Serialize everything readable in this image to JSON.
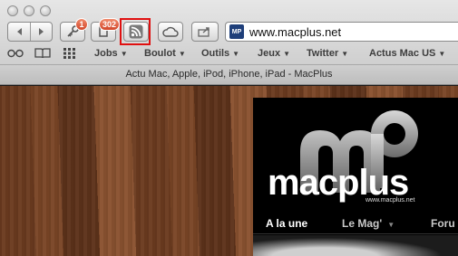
{
  "toolbar": {
    "reading_list_badge": "1",
    "bookmarks_badge": "302"
  },
  "address": {
    "favicon_text": "MP",
    "url": "www.macplus.net"
  },
  "bookmarks_bar": {
    "items": [
      {
        "label": "Jobs"
      },
      {
        "label": "Boulot"
      },
      {
        "label": "Outils"
      },
      {
        "label": "Jeux"
      },
      {
        "label": "Twitter"
      },
      {
        "label": "Actus Mac US"
      }
    ]
  },
  "tab": {
    "title": "Actu Mac, Apple, iPod, iPhone, iPad - MacPlus"
  },
  "site": {
    "logo_text": "macplus",
    "logo_url": "www.macplus.net",
    "nav": [
      {
        "label": "A la une"
      },
      {
        "label": "Le Mag'"
      },
      {
        "label": "Foru"
      }
    ]
  },
  "colors": {
    "highlight_border": "#e01010",
    "badge": "#d2472a",
    "wood": "#6b3b1f"
  }
}
